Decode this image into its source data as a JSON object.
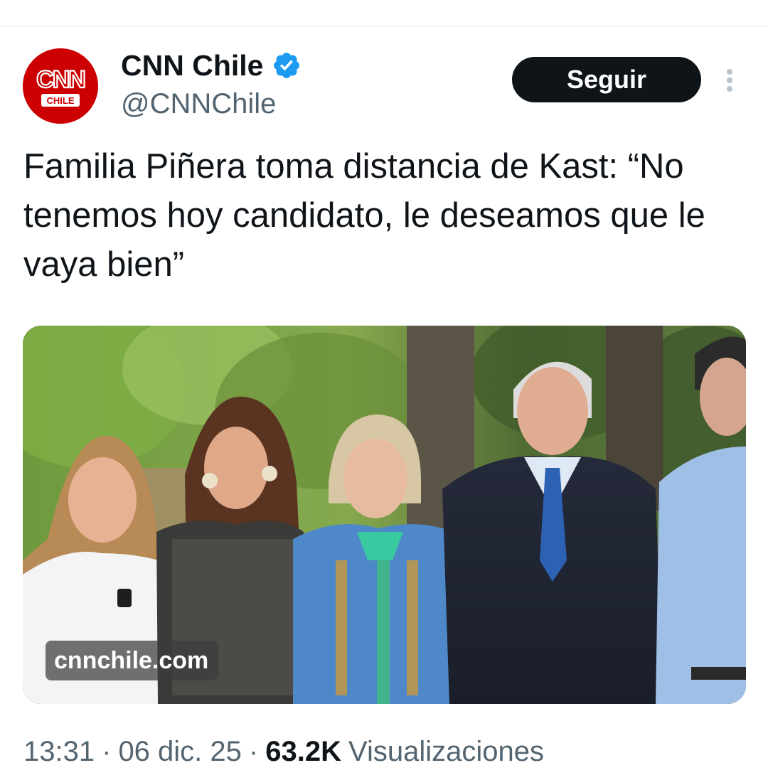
{
  "account": {
    "display_name": "CNN Chile",
    "handle": "@CNNChile",
    "verified": true,
    "avatar": {
      "logo_text": "CNN",
      "sub_text": "CHILE",
      "color": "#cc0000"
    }
  },
  "actions": {
    "follow_label": "Seguir",
    "more_icon": "more-vertical-icon"
  },
  "tweet": {
    "text": "Familia Piñera toma distancia de Kast: “No tenemos hoy candidato, le deseamos que le vaya bien”",
    "media": {
      "watermark": "cnnchile.com"
    },
    "time": "13:31",
    "separator": "·",
    "date": "06 dic. 25",
    "views_count": "63.2K",
    "views_label": "Visualizaciones"
  },
  "colors": {
    "text": "#0f1419",
    "muted": "#536471",
    "verified": "#1d9bf0",
    "follow_bg": "#0f1419",
    "brand_red": "#cc0000"
  }
}
